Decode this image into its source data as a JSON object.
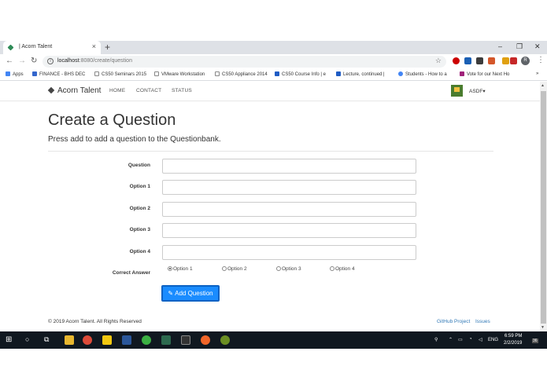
{
  "browser": {
    "tab_title": "| Acorn Talent",
    "tab_close": "×",
    "new_tab": "+",
    "window_controls": [
      "–",
      "❐",
      "✕"
    ],
    "url_host": "localhost",
    "url_path": ":8080/create/question",
    "bookmarks": [
      {
        "label": "Apps",
        "icon": "apps-grid-icon",
        "color": "#4285f4"
      },
      {
        "label": "FINANCE - BHS DEC",
        "icon": "bookmark-icon",
        "color": "#3366cc"
      },
      {
        "label": "CS50 Seminars 2015",
        "icon": "page-icon",
        "color": "#888888"
      },
      {
        "label": "VMware Workstation",
        "icon": "page-icon",
        "color": "#888888"
      },
      {
        "label": "CS50 Appliance 2014",
        "icon": "page-icon",
        "color": "#888888"
      },
      {
        "label": "CS50 Course Info | e",
        "icon": "edx-icon",
        "color": "#1f5cc4"
      },
      {
        "label": "Lecture, continued |",
        "icon": "edx-icon",
        "color": "#1f5cc4"
      },
      {
        "label": "Students - How to a",
        "icon": "google-icon",
        "color": "#4285f4"
      },
      {
        "label": "Vote for our Next Ho",
        "icon": "bookmark-icon",
        "color": "#a0227a"
      }
    ],
    "profile_initial": "R"
  },
  "navbar": {
    "brand": "Acorn Talent",
    "links": [
      "HOME",
      "CONTACT",
      "STATUS"
    ],
    "user": "ASDF"
  },
  "main": {
    "title": "Create a Question",
    "subtitle": "Press add to add a question to the Questionbank.",
    "fields": [
      {
        "label": "Question",
        "value": ""
      },
      {
        "label": "Option 1",
        "value": ""
      },
      {
        "label": "Option 2",
        "value": ""
      },
      {
        "label": "Option 3",
        "value": ""
      },
      {
        "label": "Option 4",
        "value": ""
      }
    ],
    "correct_answer_label": "Correct Answer",
    "radio_options": [
      "Option 1",
      "Option 2",
      "Option 3",
      "Option 4"
    ],
    "selected_option": "Option 1",
    "add_button": "Add Question"
  },
  "footer": {
    "copyright": "© 2019 Acorn Talent. All Rights Reserved",
    "links": [
      "GitHub Project",
      "Issues"
    ]
  },
  "taskbar": {
    "language": "ENG",
    "time": "6:59 PM",
    "date": "2/2/2019",
    "notifications": "36"
  }
}
